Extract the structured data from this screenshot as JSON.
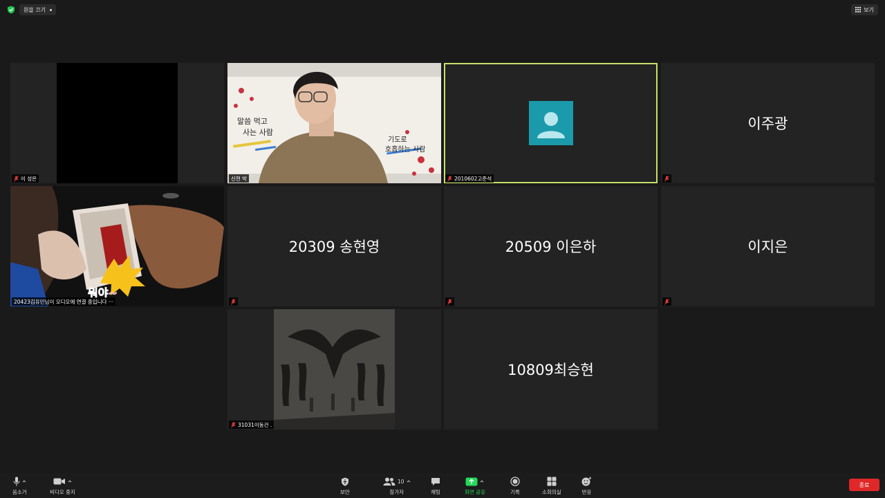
{
  "top_bar": {
    "room_label": "원을 끄기",
    "view_label": "보기"
  },
  "colors": {
    "active_border": "#c8e06b",
    "tile_bg": "#232323",
    "end_button": "#e02828",
    "share_green": "#23d959",
    "avatar_teal": "#1a9aaa"
  },
  "tiles": [
    {
      "label": "이 성은",
      "center": ""
    },
    {
      "label": "신현 박",
      "center": ""
    },
    {
      "label": "2010602고준석",
      "center": ""
    },
    {
      "label": "",
      "center": "이주광"
    },
    {
      "label": "20423김유민님이 오디오에 연결 중입니다 ···",
      "center": ""
    },
    {
      "label": "",
      "center": "20309 송현영"
    },
    {
      "label": "",
      "center": "20509 이은하"
    },
    {
      "label": "",
      "center": "이지은"
    },
    {
      "label": "31031이동건 .",
      "center": ""
    },
    {
      "label": "",
      "center": "10809최승현"
    }
  ],
  "video_caption": "뭐야~",
  "banner": {
    "line1": "말씀 먹고",
    "line2": "사는 사람",
    "line3": "기도로",
    "line4": "호흡하는 사람"
  },
  "toolbar": {
    "mute": "음소거",
    "stop_video": "비디오 중지",
    "security": "보안",
    "participants": "참가자",
    "participants_count": "10",
    "chat": "채팅",
    "share_screen": "화면 공유",
    "record": "기록",
    "breakout": "소회의실",
    "reactions": "반응",
    "end": "종료"
  }
}
